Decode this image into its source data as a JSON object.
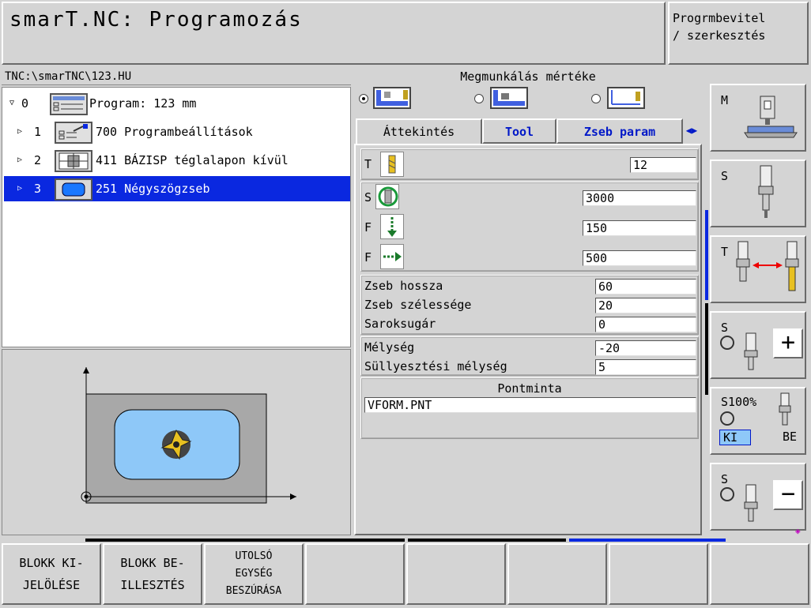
{
  "header": {
    "title": "smarT.NC: Programozás",
    "mode": "Progrmbevitel\n/ szerkesztés"
  },
  "tree": {
    "path": "TNC:\\smarTNC\\123.HU",
    "rows": [
      {
        "num": "0",
        "label": "Program: 123 mm"
      },
      {
        "num": "1",
        "label": "700 Programbeállítások"
      },
      {
        "num": "2",
        "label": "411 BÁZISP téglalapon kívül"
      },
      {
        "num": "3",
        "label": "251 Négyszögzseb"
      }
    ]
  },
  "extent": {
    "label": "Megmunkálás mértéke",
    "selected": 0
  },
  "tabs": [
    "Áttekintés",
    "Tool",
    "Zseb param"
  ],
  "form": {
    "t_label": "T",
    "t_value": "12",
    "s_label": "S",
    "s_value": "3000",
    "f1_label": "F",
    "f1_value": "150",
    "f2_label": "F",
    "f2_value": "500",
    "pocket_length_label": "Zseb hossza",
    "pocket_length_value": "60",
    "pocket_width_label": "Zseb szélessége",
    "pocket_width_value": "20",
    "corner_radius_label": "Saroksugár",
    "corner_radius_value": "0",
    "depth_label": "Mélység",
    "depth_value": "-20",
    "plunge_depth_label": "Süllyesztési mélység",
    "plunge_depth_value": "5",
    "pattern_label": "Pontminta",
    "pattern_value": "VFORM.PNT"
  },
  "side_keys": {
    "m": "M",
    "s1": "S",
    "t": "T",
    "s2": "S",
    "s100": "S100%",
    "ki": "KI",
    "be": "BE",
    "s3": "S"
  },
  "softkeys": [
    "BLOKK KI-\nJELÖLÉSE",
    "BLOKK BE-\nILLESZTÉS",
    "UTOLSÓ\nEGYSÉG\nBESZÚRÁSA",
    "",
    "",
    "",
    "",
    ""
  ],
  "colors": {
    "selection": "#0a28e0",
    "tab_text": "#0018c8",
    "pocket_fill": "#8ec8f8",
    "workpiece_fill": "#a8a8a8"
  }
}
